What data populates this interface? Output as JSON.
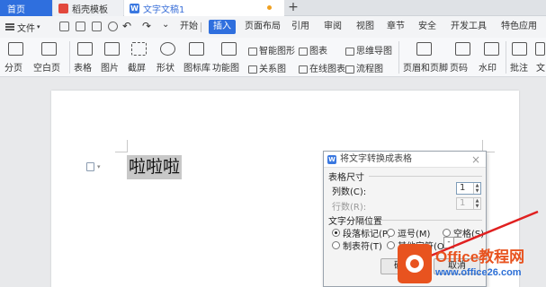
{
  "tabs": {
    "home": "首页",
    "template": "稻壳模板",
    "document": "文字文稿1",
    "doc_icon": "W",
    "plus": "+"
  },
  "menu": {
    "file": "文件",
    "items": [
      "开始",
      "插入",
      "页面布局",
      "引用",
      "审阅",
      "视图",
      "章节",
      "安全",
      "开发工具",
      "特色应用"
    ],
    "active": "插入"
  },
  "ribbon": {
    "page_break": "分页",
    "blank_page": "空白页",
    "table": "表格",
    "picture": "图片",
    "screenshot": "截屏",
    "shape": "形状",
    "icon_lib": "图标库",
    "func_chart": "功能图",
    "smart_shape": "智能图形",
    "chart": "图表",
    "mind_map": "思维导图",
    "relation": "关系图",
    "online_chart": "在线图表",
    "flowchart": "流程图",
    "header_footer": "页眉和页脚",
    "page_number": "页码",
    "watermark": "水印",
    "comment": "批注",
    "text": "文"
  },
  "document": {
    "selected_text": "啦啦啦"
  },
  "dialog": {
    "title": "将文字转换成表格",
    "logo": "W",
    "close": "×",
    "size_group": "表格尺寸",
    "columns_label": "列数(C):",
    "columns_value": "1",
    "rows_label": "行数(R):",
    "rows_value": "1",
    "sep_group": "文字分隔位置",
    "opt_para": "段落标记(P)",
    "opt_comma": "逗号(M)",
    "opt_space": "空格(S)",
    "opt_tab": "制表符(T)",
    "opt_other": "其他字符(O):",
    "other_value": "-",
    "ok": "确定",
    "cancel": "取消"
  },
  "watermark": {
    "brand": "Office教程网",
    "url": "www.office26.com"
  },
  "colors": {
    "accent": "#2f6fde",
    "brand_orange": "#e8531f",
    "arrow_red": "#e02020"
  }
}
